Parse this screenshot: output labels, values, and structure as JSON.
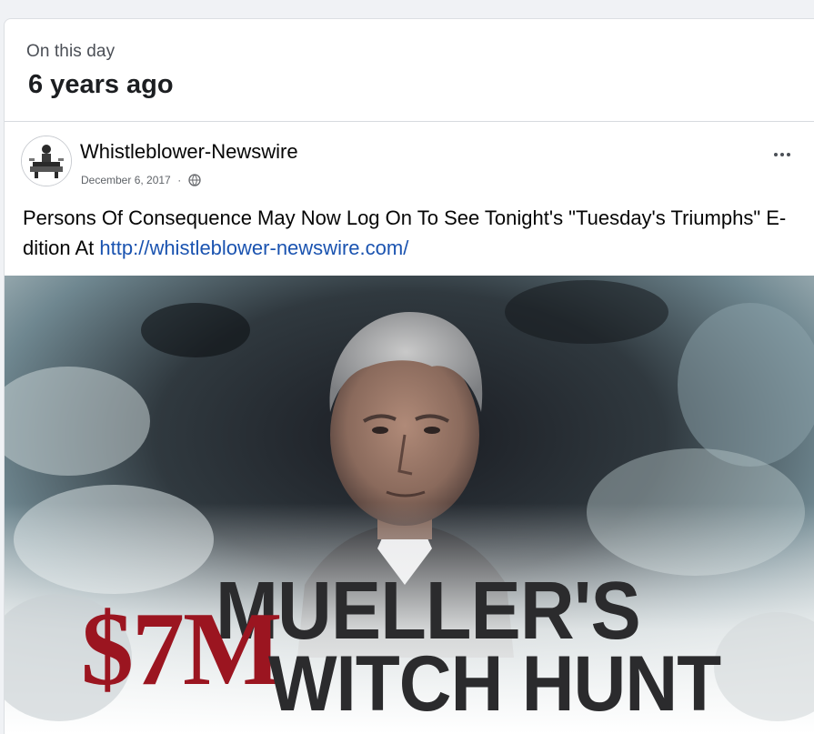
{
  "memory": {
    "kicker": "On this day",
    "title": "6 years ago"
  },
  "post": {
    "author": "Whistleblower-Newswire",
    "date": "December 6, 2017",
    "separator": "·",
    "audience_icon": "globe-icon",
    "more_icon": "more-options-icon",
    "text": "Persons Of Consequence May Now Log On To See Tonight's \"Tuesday's Triumphs\" E-dition At",
    "link": "http://whistleblower-newswire.com/"
  },
  "image": {
    "headline_line1": "MUELLER'S",
    "headline_amount": "$7M",
    "headline_line2": "WITCH HUNT"
  },
  "colors": {
    "link": "#1a53b0",
    "headline_red": "#9b1520",
    "headline_dark": "#2b2b2d"
  }
}
